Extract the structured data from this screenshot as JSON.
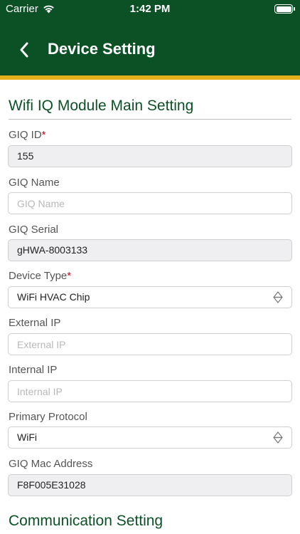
{
  "status_bar": {
    "carrier": "Carrier",
    "time": "1:42 PM"
  },
  "header": {
    "title": "Device Setting",
    "back_icon": "chevron-left-icon"
  },
  "colors": {
    "header_bg": "#0c5126",
    "accent_stripe": "#e5ae1b",
    "section_title": "#0c5126",
    "required": "#d0021b",
    "readonly_bg": "#efeff1"
  },
  "sections": {
    "main": {
      "title": "Wifi IQ Module Main Setting"
    },
    "communication": {
      "title": "Communication Setting"
    }
  },
  "fields": {
    "giq_id": {
      "label": "GIQ ID",
      "required_mark": "*",
      "value": "155"
    },
    "giq_name": {
      "label": "GIQ Name",
      "placeholder": "GIQ Name",
      "value": ""
    },
    "giq_serial": {
      "label": "GIQ Serial",
      "value": "gHWA-8003133"
    },
    "device_type": {
      "label": "Device Type",
      "required_mark": "*",
      "value": "WiFi HVAC Chip"
    },
    "external_ip": {
      "label": "External IP",
      "placeholder": "External IP",
      "value": ""
    },
    "internal_ip": {
      "label": "Internal IP",
      "placeholder": "Internal IP",
      "value": ""
    },
    "primary_protocol": {
      "label": "Primary Protocol",
      "value": "WiFi"
    },
    "giq_mac": {
      "label": "GIQ Mac Address",
      "value": "F8F005E31028"
    }
  }
}
